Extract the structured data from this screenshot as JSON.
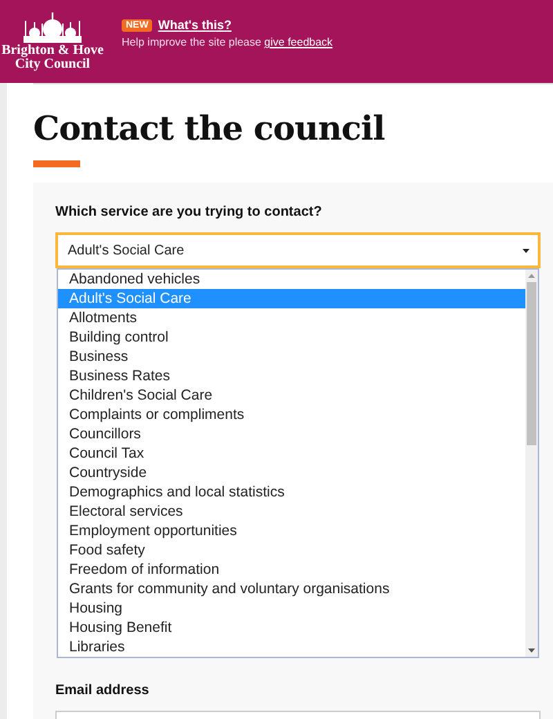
{
  "header": {
    "logo_lines": [
      "Brighton & Hove",
      "City Council"
    ],
    "badge": "NEW",
    "info_link": "What's this?",
    "message": "Help improve the site please ",
    "feedback_link": "give feedback"
  },
  "title": "Contact the council",
  "form": {
    "service_label": "Which service are you trying to contact?",
    "service_value": "Adult's Social Care",
    "options": [
      {
        "label": "Abandoned vehicles",
        "selected": false
      },
      {
        "label": "Adult's Social Care",
        "selected": true
      },
      {
        "label": "Allotments",
        "selected": false
      },
      {
        "label": "Building control",
        "selected": false
      },
      {
        "label": "Business",
        "selected": false
      },
      {
        "label": "Business Rates",
        "selected": false
      },
      {
        "label": "Children's Social Care",
        "selected": false
      },
      {
        "label": "Complaints or compliments",
        "selected": false
      },
      {
        "label": "Councillors",
        "selected": false
      },
      {
        "label": "Council Tax",
        "selected": false
      },
      {
        "label": "Countryside",
        "selected": false
      },
      {
        "label": "Demographics and local statistics",
        "selected": false
      },
      {
        "label": "Electoral services",
        "selected": false
      },
      {
        "label": "Employment opportunities",
        "selected": false
      },
      {
        "label": "Food safety",
        "selected": false
      },
      {
        "label": "Freedom of information",
        "selected": false
      },
      {
        "label": "Grants for community and voluntary organisations",
        "selected": false
      },
      {
        "label": "Housing",
        "selected": false
      },
      {
        "label": "Housing Benefit",
        "selected": false
      },
      {
        "label": "Libraries",
        "selected": false
      }
    ],
    "email_label": "Email address"
  }
}
